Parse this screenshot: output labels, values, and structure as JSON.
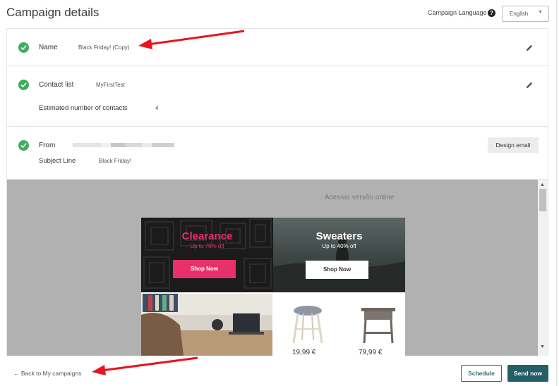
{
  "header": {
    "title": "Campaign details",
    "language_label": "Campaign Language",
    "help_icon": "?",
    "language_value": "English"
  },
  "sections": {
    "name": {
      "label": "Name",
      "value": "Black Friday! (Copy)"
    },
    "contact": {
      "label": "Contact list",
      "value": "MyFirstTest",
      "estimate_label": "Estimated number of contacts",
      "estimate_value": "4"
    },
    "from": {
      "label": "From",
      "subject_label": "Subject Line",
      "subject_value": "Black Friday!",
      "design_button": "Design email"
    }
  },
  "preview": {
    "online_link": "Acessar versão online",
    "banner_left": {
      "title": "Clearance",
      "subtitle": "Up to 70% off",
      "button": "Shop Now"
    },
    "banner_right": {
      "title": "Sweaters",
      "subtitle": "Up to 40% off",
      "button": "Shop Now"
    },
    "prices": [
      "19,99 €",
      "79,99 €"
    ]
  },
  "footer": {
    "back_link": "Back to My campaigns",
    "back_arrow": "←",
    "schedule_button": "Schedule",
    "send_button": "Send now"
  },
  "colors": {
    "success_check": "#3fae5e",
    "clearance_pink": "#e8306a",
    "primary_teal": "#245e68",
    "annotation_red": "#e8141e"
  },
  "icons": {
    "check": "check-circle-icon",
    "edit": "pencil-icon",
    "help": "question-circle-icon",
    "dropdown": "chevron-down-icon"
  }
}
